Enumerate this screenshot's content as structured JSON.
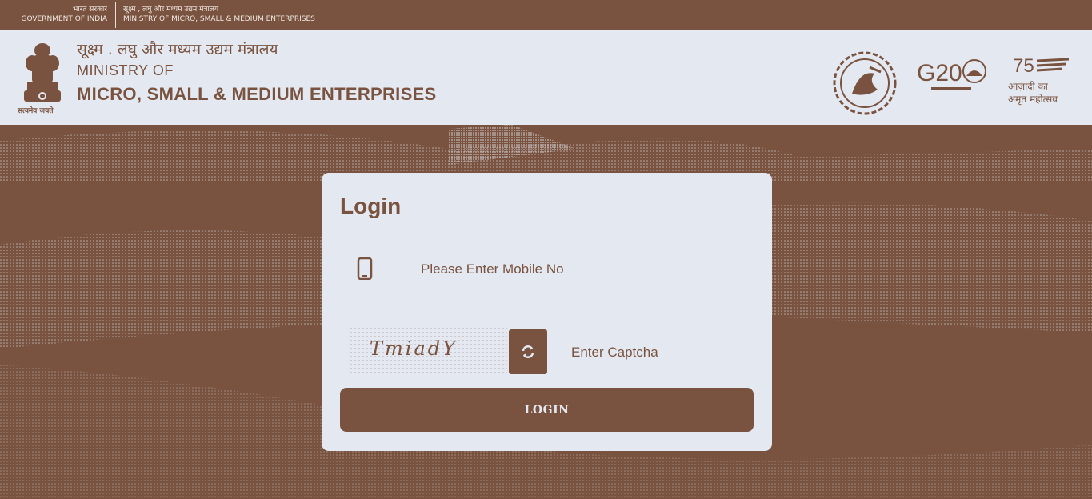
{
  "topbar": {
    "gov_hi": "भारत सरकार",
    "gov_en": "GOVERNMENT OF INDIA",
    "ministry_hi": "सूक्ष्म , लघु और मध्यम उद्यम मंत्रालय",
    "ministry_en": "MINISTRY OF MICRO, SMALL & MEDIUM ENTERPRISES"
  },
  "header": {
    "title_hi": "सूक्ष्म . लघु और मध्यम उद्यम मंत्रालय",
    "title_line1": "MINISTRY OF",
    "title_line2": "MICRO, SMALL & MEDIUM ENTERPRISES",
    "emblem_motto": "सत्यमेव जयते",
    "logos": [
      "pm-vishwakarma-logo",
      "g20-logo",
      "azadi-ka-amrit-mahotsav-logo"
    ],
    "g20_label": "G20",
    "azadi_label": "आज़ादी का अमृत महोत्सव"
  },
  "login": {
    "title": "Login",
    "mobile_placeholder": "Please Enter Mobile No",
    "captcha_text": "TmiadY",
    "captcha_placeholder": "Enter Captcha",
    "button_label": "LOGIN"
  },
  "colors": {
    "primary": "#79533f",
    "light": "#e4e8f1"
  }
}
